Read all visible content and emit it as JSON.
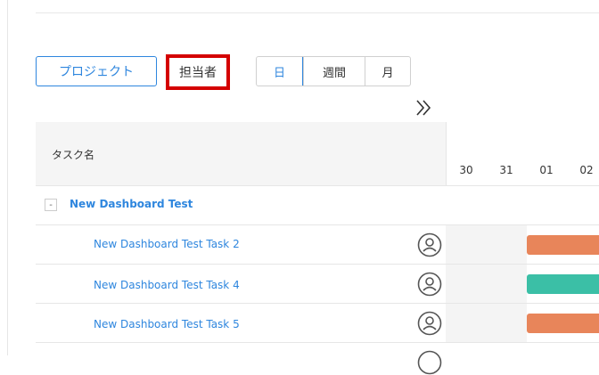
{
  "toolbar": {
    "project_label": "プロジェクト",
    "assignee_label": "担当者",
    "view_options": [
      "日",
      "週間",
      "月"
    ],
    "expand_label": "»"
  },
  "grid": {
    "column_title": "タスク名"
  },
  "timeline": {
    "days": [
      "30",
      "31",
      "01",
      "02"
    ]
  },
  "rows": [
    {
      "type": "group",
      "toggle": "-",
      "name": "New Dashboard Test"
    },
    {
      "type": "task",
      "name": "New Dashboard Test Task 2",
      "bar_color": "#e8855a"
    },
    {
      "type": "task",
      "name": "New Dashboard Test Task 4",
      "bar_color": "#3bbfa6"
    },
    {
      "type": "task",
      "name": "New Dashboard Test Task 5",
      "bar_color": "#e8855a"
    }
  ],
  "colors": {
    "accent": "#2e86de",
    "highlight": "#d40000"
  }
}
